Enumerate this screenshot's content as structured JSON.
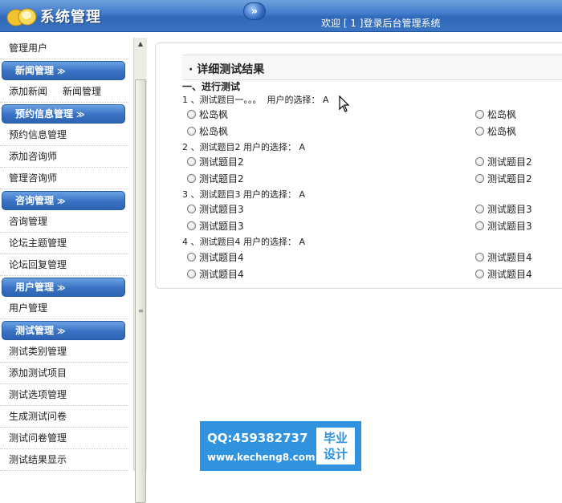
{
  "header": {
    "app_title": "系统管理",
    "toggle_label": "»",
    "welcome_text": "欢迎 [ 1 ]登录后台管理系统"
  },
  "sidebar": {
    "top_item": "管理用户",
    "groups": [
      {
        "title": "新闻管理",
        "items": [
          "添加新闻",
          "新闻管理"
        ]
      },
      {
        "title": "预约信息管理",
        "items": [
          "预约信息管理",
          "添加咨询师",
          "管理咨询师"
        ]
      },
      {
        "title": "咨询管理",
        "items": [
          "咨询管理",
          "论坛主题管理",
          "论坛回复管理"
        ]
      },
      {
        "title": "用户管理",
        "items": [
          "用户管理"
        ]
      },
      {
        "title": "测试管理",
        "items": [
          "测试类别管理",
          "添加测试项目",
          "测试选项管理",
          "生成测试问卷",
          "测试问卷管理",
          "测试结果显示"
        ]
      }
    ],
    "chevron": "≫"
  },
  "main": {
    "panel_title": "· 详细测试结果",
    "section_title": "一、进行测试",
    "questions": [
      {
        "line": "1 、测试题目一。。。  用户的选择： A",
        "options": [
          "松岛枫",
          "松岛枫",
          "松岛枫",
          "松岛枫"
        ]
      },
      {
        "line": "2 、测试题目2 用户的选择： A",
        "options": [
          "测试题目2",
          "测试题目2",
          "测试题目2",
          "测试题目2"
        ]
      },
      {
        "line": "3 、测试题目3 用户的选择： A",
        "options": [
          "测试题目3",
          "测试题目3",
          "测试题目3",
          "测试题目3"
        ]
      },
      {
        "line": "4 、测试题目4 用户的选择： A",
        "options": [
          "测试题目4",
          "测试题目4",
          "测试题目4",
          "测试题目4"
        ]
      }
    ]
  },
  "watermark": {
    "qq": "QQ:459382737",
    "site": "www.kecheng8.com",
    "badge_line1": "毕业",
    "badge_line2": "设计"
  },
  "colors": {
    "header_blue": "#3f79c8",
    "watermark_blue": "#2f93df"
  },
  "icons": [
    "logo-icon",
    "double-arrow-icon",
    "chevron-double-down-icon",
    "radio-icon",
    "mouse-cursor-icon",
    "scroll-up-arrow-icon"
  ]
}
